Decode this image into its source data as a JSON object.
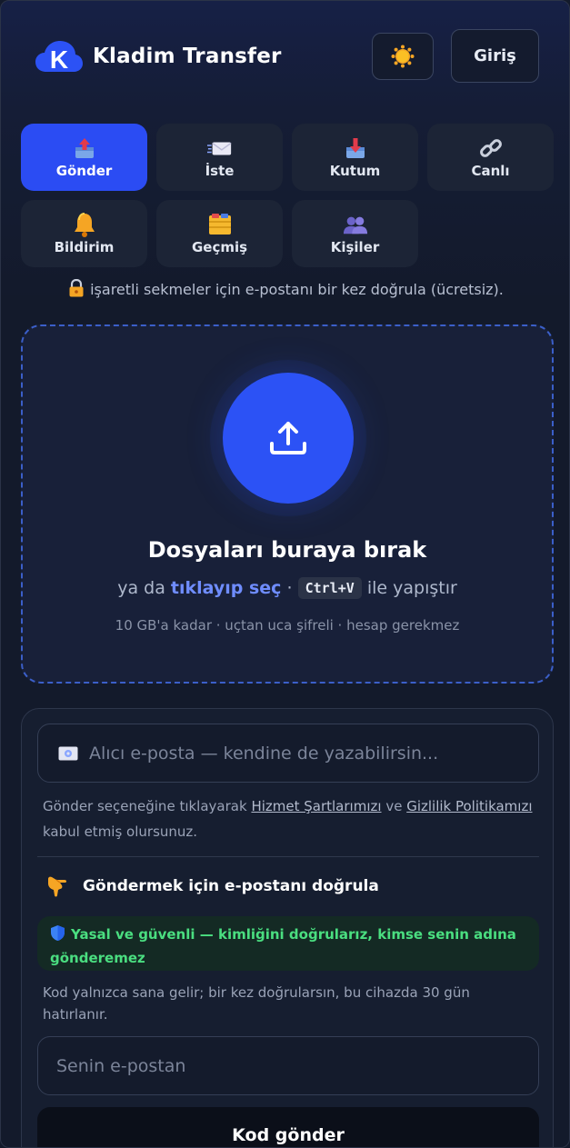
{
  "header": {
    "brand": "Kladim Transfer",
    "logo_letter": "K",
    "theme_icon": "sun-icon",
    "login_label": "Giriş"
  },
  "tabs": [
    {
      "label": "Gönder",
      "icon": "outbox-tray-icon",
      "active": true
    },
    {
      "label": "İste",
      "icon": "incoming-envelope-icon",
      "active": false
    },
    {
      "label": "Kutum",
      "icon": "inbox-tray-icon",
      "active": false
    },
    {
      "label": "Canlı",
      "icon": "link-icon",
      "active": false
    },
    {
      "label": "Bildirim",
      "icon": "bell-icon",
      "active": false
    },
    {
      "label": "Geçmiş",
      "icon": "card-index-dividers-icon",
      "active": false
    },
    {
      "label": "Kişiler",
      "icon": "busts-icon",
      "active": false
    }
  ],
  "notice": "işaretli sekmeler için e-postanı bir kez doğrula (ücretsiz).",
  "dropzone": {
    "title": "Dosyaları buraya bırak",
    "sub_prefix": "ya da",
    "sub_link": "tıklayıp seç",
    "sub_sep": "·",
    "shortcut": "Ctrl+V",
    "sub_suffix": "ile yapıştır",
    "note": "10 GB'a kadar · uçtan uca şifreli · hesap gerekmez"
  },
  "form": {
    "recipient_placeholder": "Alıcı e-posta — kendine de yazabilirsin...",
    "terms_prefix": "Gönder seçeneğine tıklayarak",
    "terms_link1": "Hizmet Şartlarımızı",
    "terms_mid": "ve",
    "terms_link2": "Gizlilik Politikamızı",
    "terms_suffix": "kabul etmiş olursunuz.",
    "verify_title": "Göndermek için e-postanı doğrula",
    "safe_text": "Yasal ve güvenli — kimliğini doğrularız, kimse senin adına gönderemez",
    "hint": "Kod yalnızca sana gelir; bir kez doğrularsın, bu cihazda 30 gün hatırlanır.",
    "email_placeholder": "Senin e-postan",
    "send_label": "Kod gönder"
  },
  "colors": {
    "accent": "#2b4cf3",
    "link": "#6f8dff",
    "success": "#4ade80",
    "background": "#131a2b"
  }
}
